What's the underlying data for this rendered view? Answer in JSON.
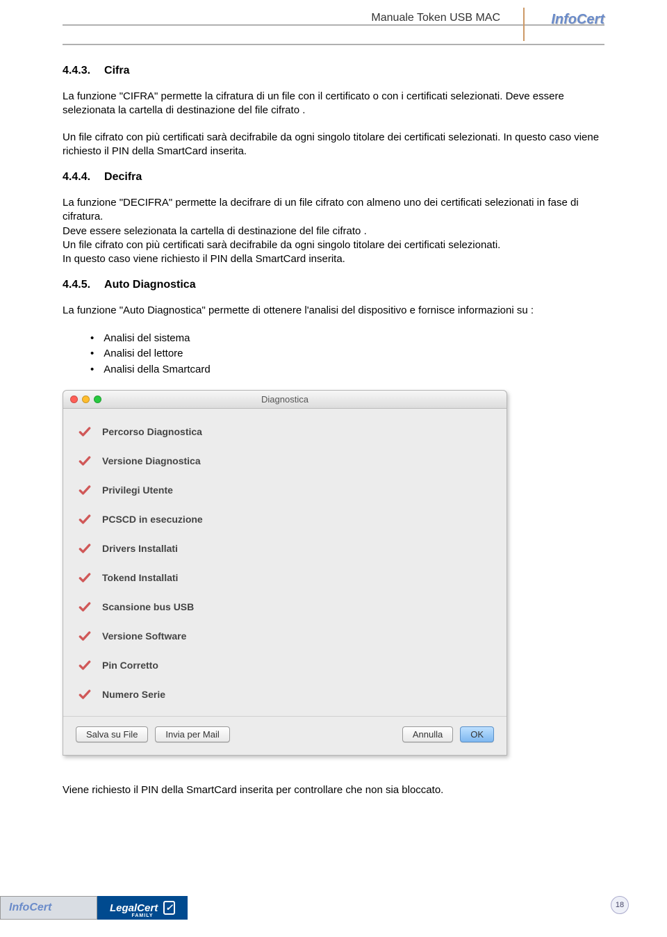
{
  "header": {
    "title": "Manuale Token USB MAC",
    "brand": "InfoCert"
  },
  "sections": {
    "s443": {
      "num": "4.4.3.",
      "title": "Cifra",
      "para1": "La funzione \"CIFRA\" permette la cifratura di un file con il certificato o con i certificati selezionati. Deve essere selezionata la cartella di destinazione del file cifrato .",
      "para2": "Un file cifrato con più certificati sarà decifrabile da ogni singolo titolare dei certificati selezionati. In questo caso viene richiesto il PIN della SmartCard inserita."
    },
    "s444": {
      "num": "4.4.4.",
      "title": "Decifra",
      "para1": "La funzione \"DECIFRA\" permette la decifrare di un file cifrato con almeno uno dei certificati selezionati in fase di cifratura.",
      "para2": "Deve essere selezionata la cartella di destinazione del file cifrato .",
      "para3": "Un file cifrato con più certificati sarà decifrabile da ogni singolo titolare dei certificati selezionati.",
      "para4": " In questo caso viene richiesto il PIN della SmartCard inserita."
    },
    "s445": {
      "num": "4.4.5.",
      "title": "Auto Diagnostica",
      "intro": "La funzione \"Auto Diagnostica\" permette di ottenere l'analisi del dispositivo e fornisce informazioni su :",
      "bullets": [
        "Analisi del sistema",
        "Analisi del lettore",
        "Analisi della Smartcard"
      ],
      "closing": "Viene richiesto il PIN della SmartCard inserita per controllare che non sia bloccato."
    }
  },
  "dialog": {
    "title": "Diagnostica",
    "items": [
      "Percorso Diagnostica",
      "Versione Diagnostica",
      "Privilegi Utente",
      "PCSCD in esecuzione",
      "Drivers Installati",
      "Tokend Installati",
      "Scansione bus USB",
      "Versione Software",
      "Pin Corretto",
      "Numero Serie"
    ],
    "buttons": {
      "save": "Salva su File",
      "mail": "Invia per Mail",
      "cancel": "Annulla",
      "ok": "OK"
    }
  },
  "footer": {
    "brand1": "InfoCert",
    "brand2": "LegalCert",
    "family": "FAMILY",
    "page": "18"
  }
}
